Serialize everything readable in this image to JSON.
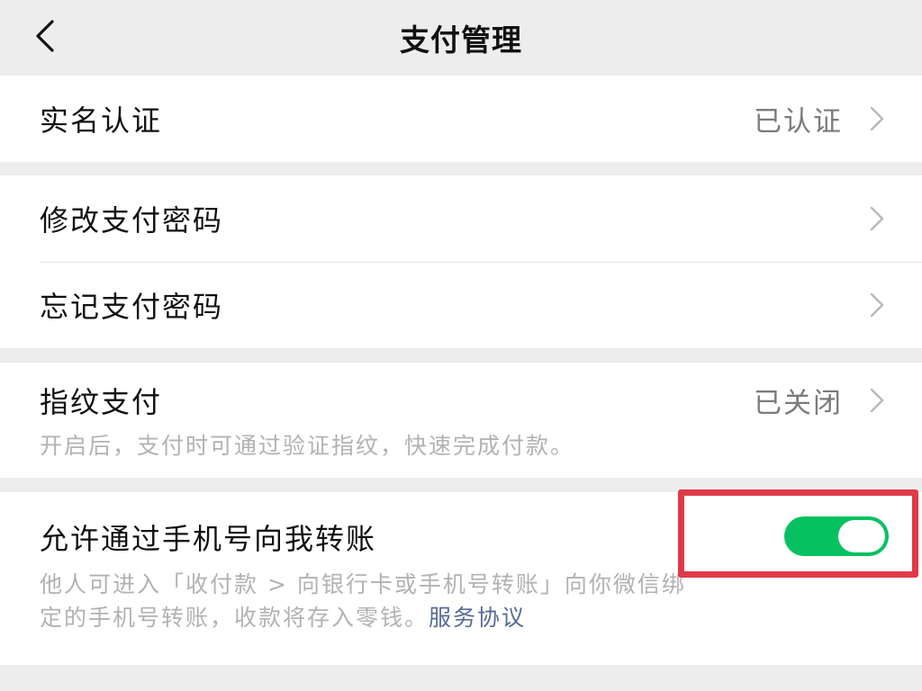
{
  "header": {
    "title": "支付管理",
    "back_icon": "chevron-left-icon"
  },
  "rows": {
    "real_name": {
      "label": "实名认证",
      "value": "已认证"
    },
    "change_password": {
      "label": "修改支付密码"
    },
    "forgot_password": {
      "label": "忘记支付密码"
    },
    "fingerprint": {
      "label": "指纹支付",
      "value": "已关闭",
      "description": "开启后，支付时可通过验证指纹，快速完成付款。"
    },
    "phone_transfer": {
      "label": "允许通过手机号向我转账",
      "toggle_on": true,
      "description_line1": "他人可进入「收付款 > 向银行卡或手机号转账」向你微信绑",
      "description_line2": "定的手机号转账，收款将存入零钱。",
      "link_text": "服务协议"
    }
  },
  "colors": {
    "background": "#ededed",
    "card": "#ffffff",
    "toggle_on": "#07c160",
    "link": "#576b95",
    "secondary_text": "#7b7b7b",
    "hint_text": "#b2b2b2",
    "highlight_border": "#e03a4a"
  }
}
